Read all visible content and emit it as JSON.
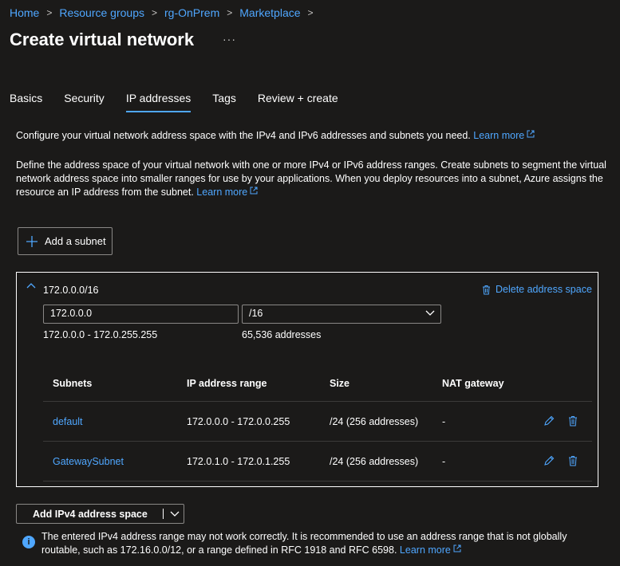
{
  "breadcrumb": [
    "Home",
    "Resource groups",
    "rg-OnPrem",
    "Marketplace"
  ],
  "page": {
    "title": "Create virtual network",
    "more": "···"
  },
  "tabs": [
    {
      "label": "Basics",
      "active": false
    },
    {
      "label": "Security",
      "active": false
    },
    {
      "label": "IP addresses",
      "active": true
    },
    {
      "label": "Tags",
      "active": false
    },
    {
      "label": "Review + create",
      "active": false
    }
  ],
  "intro": {
    "text1": "Configure your virtual network address space with the IPv4 and IPv6 addresses and subnets you need.",
    "text2": "Define the address space of your virtual network with one or more IPv4 or IPv6 address ranges. Create subnets to segment the virtual network address space into smaller ranges for use by your applications. When you deploy resources into a subnet, Azure assigns the resource an IP address from the subnet.",
    "learn_more": "Learn more"
  },
  "add_subnet_label": "Add a subnet",
  "address_space": {
    "title": "172.0.0.0/16",
    "delete_label": "Delete address space",
    "ip_value": "172.0.0.0",
    "prefix_value": "/16",
    "range": "172.0.0.0 - 172.0.255.255",
    "count": "65,536 addresses"
  },
  "subnets_table": {
    "headers": [
      "Subnets",
      "IP address range",
      "Size",
      "NAT gateway"
    ],
    "rows": [
      {
        "name": "default",
        "range": "172.0.0.0 - 172.0.0.255",
        "size": "/24 (256 addresses)",
        "nat": "-"
      },
      {
        "name": "GatewaySubnet",
        "range": "172.0.1.0 - 172.0.1.255",
        "size": "/24 (256 addresses)",
        "nat": "-"
      }
    ]
  },
  "add_space_label": "Add IPv4 address space",
  "info": {
    "text": "The entered IPv4 address range may not work correctly. It is recommended to use an address range that is not globally routable, such as 172.16.0.0/12, or a range defined in RFC 1918 and RFC 6598.",
    "learn_more": "Learn more",
    "icon": "i"
  },
  "colors": {
    "background": "#1b1a19",
    "accent": "#4fa7ff",
    "border": "#8a8886"
  }
}
